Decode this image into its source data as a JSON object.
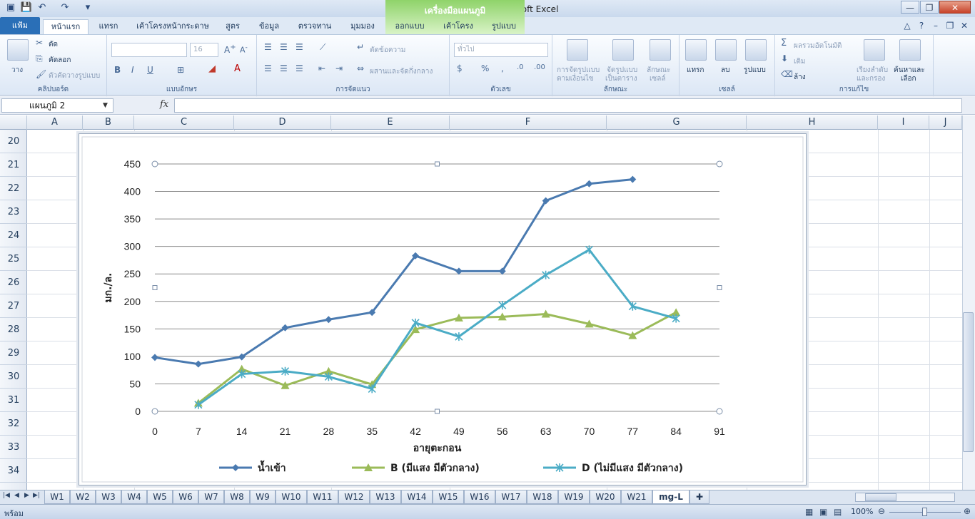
{
  "window": {
    "title": "-CP-COD ตัวกลาง  -  Microsoft Excel",
    "context_tools": "เครื่องมือแผนภูมิ"
  },
  "ribbon_tabs": [
    {
      "label": "แฟ้ม"
    },
    {
      "label": "หน้าแรก"
    },
    {
      "label": "แทรก"
    },
    {
      "label": "เค้าโครงหน้ากระดาษ"
    },
    {
      "label": "สูตร"
    },
    {
      "label": "ข้อมูล"
    },
    {
      "label": "ตรวจทาน"
    },
    {
      "label": "มุมมอง"
    },
    {
      "label": "ออกแบบ"
    },
    {
      "label": "เค้าโครง"
    },
    {
      "label": "รูปแบบ"
    }
  ],
  "ribbon": {
    "clipboard": {
      "paste": "วาง",
      "cut": "ตัด",
      "copy": "คัดลอก",
      "format_painter": "ตัวคัดวางรูปแบบ",
      "label": "คลิปบอร์ด"
    },
    "font": {
      "name": "",
      "size": "16",
      "label": "แบบอักษร"
    },
    "alignment": {
      "wrap": "ตัดข้อความ",
      "merge": "ผสานและจัดกึ่งกลาง",
      "label": "การจัดแนว"
    },
    "number": {
      "format": "ทั่วไป",
      "label": "ตัวเลข"
    },
    "styles": {
      "conditional_1": "การจัดรูปแบบ",
      "conditional_2": "ตามเงื่อนไข",
      "table_1": "จัดรูปแบบ",
      "table_2": "เป็นตาราง",
      "cell_1": "ลักษณะ",
      "cell_2": "เซลล์",
      "label": "ลักษณะ"
    },
    "cells": {
      "insert": "แทรก",
      "delete": "ลบ",
      "format": "รูปแบบ",
      "label": "เซลล์"
    },
    "editing": {
      "autosum": "ผลรวมอัตโนมัติ",
      "fill": "เติม",
      "clear": "ล้าง",
      "sort_1": "เรียงลำดับ",
      "sort_2": "และกรอง",
      "find_1": "ค้นหาและ",
      "find_2": "เลือก",
      "label": "การแก้ไข"
    }
  },
  "formula_bar": {
    "name_box": "แผนภูมิ   2",
    "fx": "fx",
    "value": ""
  },
  "columns": [
    "A",
    "B",
    "C",
    "D",
    "E",
    "F",
    "G",
    "H",
    "I",
    "J"
  ],
  "rows": [
    "20",
    "21",
    "22",
    "23",
    "24",
    "25",
    "26",
    "27",
    "28",
    "29",
    "30",
    "31",
    "32",
    "33",
    "34"
  ],
  "sheet_tabs": [
    "W1",
    "W2",
    "W3",
    "W4",
    "W5",
    "W6",
    "W7",
    "W8",
    "W9",
    "W10",
    "W11",
    "W12",
    "W13",
    "W14",
    "W15",
    "W16",
    "W17",
    "W18",
    "W19",
    "W20",
    "W21",
    "mg-L"
  ],
  "active_sheet": "mg-L",
  "status": {
    "ready": "พร้อม",
    "zoom": "100%"
  },
  "chart_data": {
    "type": "line",
    "title": "",
    "xlabel": "อายุตะกอน",
    "ylabel": "มก./ล.",
    "x_ticks": [
      0,
      7,
      14,
      21,
      28,
      35,
      42,
      49,
      56,
      63,
      70,
      77,
      84,
      91
    ],
    "xlim": [
      0,
      91
    ],
    "ylim": [
      0,
      450
    ],
    "y_ticks": [
      0,
      50,
      100,
      150,
      200,
      250,
      300,
      350,
      400,
      450
    ],
    "grid": true,
    "legend_position": "bottom",
    "series": [
      {
        "name": "น้ำเข้า",
        "color": "#4a7ab0",
        "marker": "diamond",
        "x": [
          0,
          7,
          14,
          21,
          28,
          35,
          42,
          49,
          56,
          63,
          70,
          77
        ],
        "y": [
          98,
          86,
          99,
          152,
          167,
          180,
          283,
          255,
          255,
          383,
          414,
          422
        ]
      },
      {
        "name": "B (มีแสง  มีตัวกลาง)",
        "color": "#9bbb59",
        "marker": "triangle",
        "x": [
          7,
          14,
          21,
          28,
          35,
          42,
          49,
          56,
          63,
          70,
          77,
          84
        ],
        "y": [
          15,
          77,
          47,
          73,
          49,
          149,
          170,
          172,
          177,
          159,
          138,
          180
        ]
      },
      {
        "name": "D (ไม่มีแสง  มีตัวกลาง)",
        "color": "#4bacc6",
        "marker": "star",
        "x": [
          7,
          14,
          21,
          28,
          35,
          42,
          49,
          56,
          63,
          70,
          77,
          84
        ],
        "y": [
          12,
          68,
          73,
          63,
          41,
          161,
          136,
          193,
          248,
          294,
          191,
          169
        ]
      }
    ]
  }
}
